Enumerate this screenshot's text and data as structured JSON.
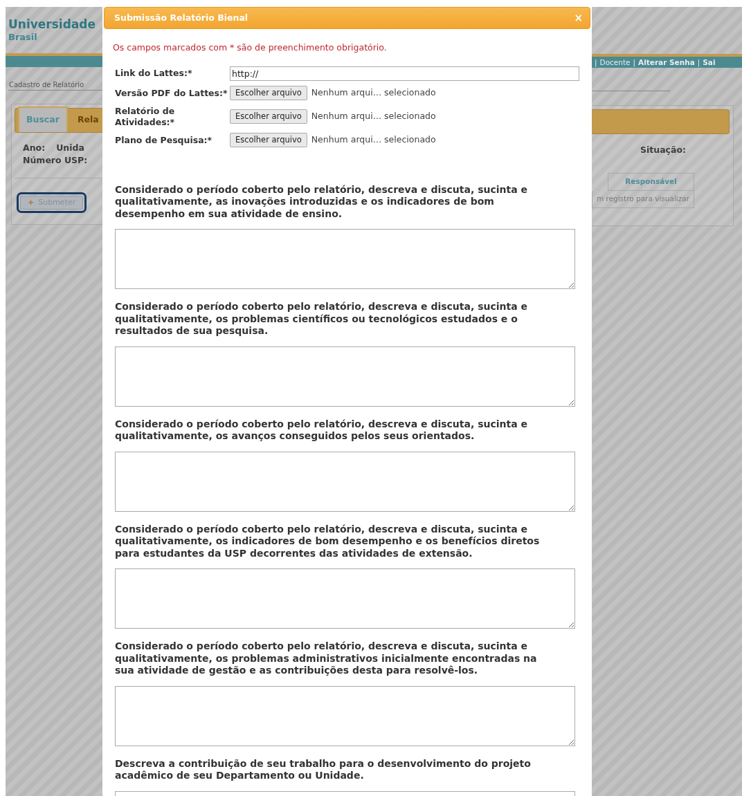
{
  "background_page": {
    "logo": {
      "title": "Universidade",
      "subtitle": "Brasil"
    },
    "nav_separator": "|",
    "nav_links": [
      {
        "label": "Docente",
        "bold": false
      },
      {
        "label": "Alterar Senha",
        "bold": true
      },
      {
        "label": "Sai",
        "bold": true
      }
    ],
    "breadcrumb": "Cadastro de Relatório",
    "tabs": [
      {
        "label": "Buscar",
        "selected": true
      },
      {
        "label": "Rela",
        "selected": false
      }
    ],
    "fields_left": [
      "Ano:",
      "Unida",
      "Número USP:"
    ],
    "fields_right": [
      "Situação:"
    ],
    "table": {
      "columns": [
        "Responsável"
      ],
      "empty_message": "m registro para visualizar"
    },
    "submit_button": {
      "label": "Submeter",
      "icon": "+",
      "focused": true
    }
  },
  "modal": {
    "title": "Submissão Relatório Bienal",
    "close": "×",
    "note": "Os campos marcados com * são de preenchimento obrigatório.",
    "fields": [
      {
        "kind": "text",
        "label": "Link do Lattes:*",
        "value": "http://"
      },
      {
        "kind": "file",
        "label": "Versão PDF do Lattes:*",
        "button": "Escolher arquivo",
        "status": "Nenhum arqui… selecionado"
      },
      {
        "kind": "file",
        "label": "Relatório de Atividades:*",
        "button": "Escolher arquivo",
        "status": "Nenhum arqui… selecionado"
      },
      {
        "kind": "file",
        "label": "Plano de Pesquisa:*",
        "button": "Escolher arquivo",
        "status": "Nenhum arqui… selecionado"
      }
    ],
    "questions": [
      "Considerado o período coberto pelo relatório, descreva e discuta, sucinta e qualitativamente, as inovações introduzidas e os indicadores de bom desempenho em sua atividade de ensino.",
      "Considerado o período coberto pelo relatório, descreva e discuta, sucinta e qualitativamente, os problemas científicos ou tecnológicos estudados e o resultados de sua pesquisa.",
      "Considerado o período coberto pelo relatório, descreva e discuta, sucinta e qualitativamente, os avanços conseguidos pelos seus orientados.",
      "Considerado o período coberto pelo relatório, descreva e discuta, sucinta e qualitativamente, os indicadores de bom desempenho e os benefícios diretos para estudantes da USP decorrentes das atividades de extensão.",
      "Considerado o período coberto pelo relatório, descreva e discuta, sucinta e qualitativamente, os problemas administrativos inicialmente encontradas na sua atividade de gestão e as contribuições desta para resolvê-los.",
      "Descreva a contribuição de seu trabalho para o desenvolvimento do projeto acadêmico de seu Departamento ou Unidade."
    ]
  }
}
